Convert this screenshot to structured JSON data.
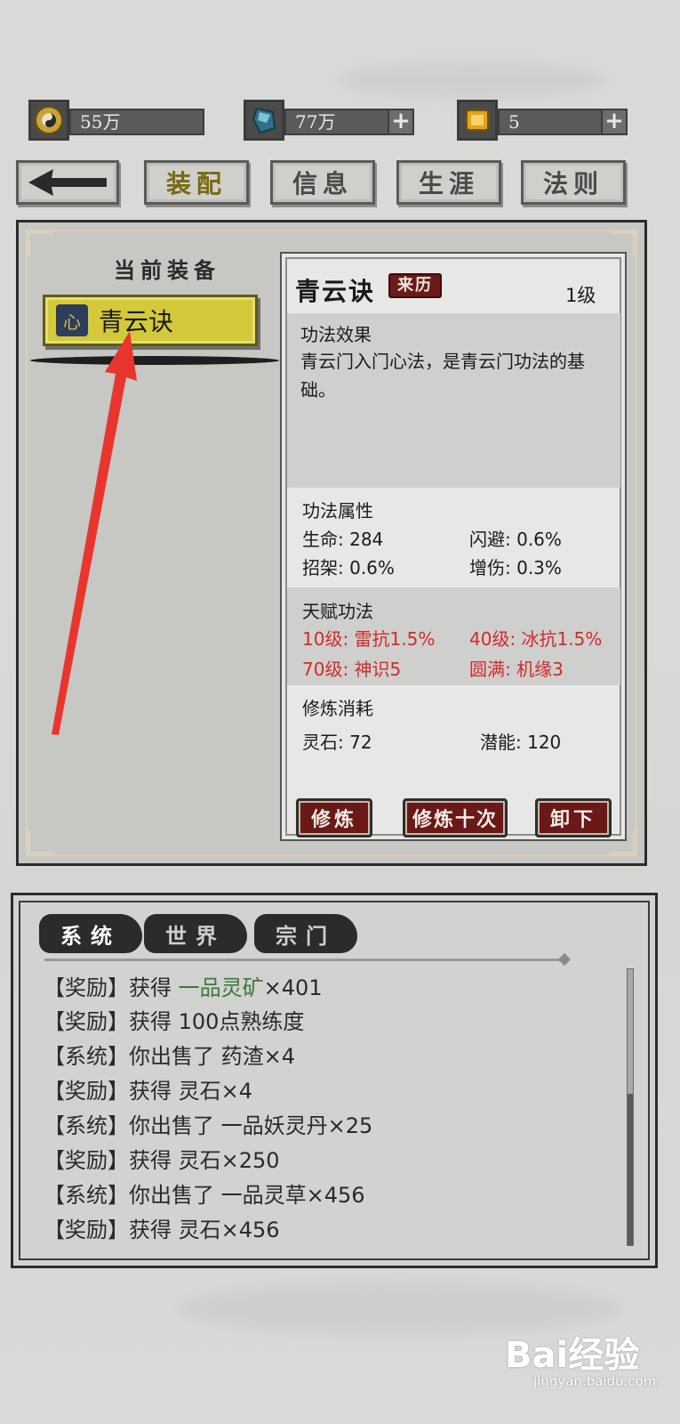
{
  "resources": [
    {
      "icon": "yin-yang-coin-icon",
      "value": "55万",
      "has_plus": false
    },
    {
      "icon": "blue-crystal-icon",
      "value": "77万",
      "has_plus": true
    },
    {
      "icon": "gold-gem-icon",
      "value": "5",
      "has_plus": true
    }
  ],
  "nav": {
    "back_icon": "back-arrow-icon",
    "tabs": [
      "装配",
      "信息",
      "生涯",
      "法则"
    ],
    "active_tab": "装配"
  },
  "equip": {
    "header": "当前装备",
    "item_icon_glyph": "心",
    "item_name": "青云诀"
  },
  "detail": {
    "name": "青云诀",
    "origin_button": "来历",
    "level": "1级",
    "effect_title": "功法效果",
    "effect_text_line1": "青云门入门心法，是青云门功法的基",
    "effect_text_line2": "础。",
    "attr_title": "功法属性",
    "attrs": [
      {
        "label": "生命: 284"
      },
      {
        "label": "闪避: 0.6%"
      },
      {
        "label": "招架: 0.6%"
      },
      {
        "label": "增伤: 0.3%"
      }
    ],
    "talent_title": "天赋功法",
    "talents": [
      {
        "label": "10级: 雷抗1.5%"
      },
      {
        "label": "40级: 冰抗1.5%"
      },
      {
        "label": "70级: 神识5"
      },
      {
        "label": "圆满: 机缘3"
      }
    ],
    "cost_title": "修炼消耗",
    "cost_stone": "灵石: 72",
    "cost_potential": "潜能: 120",
    "buttons": {
      "train": "修炼",
      "train_ten": "修炼十次",
      "unequip": "卸下"
    },
    "talent_color": "#d32a2a"
  },
  "chat": {
    "tabs": [
      "系统",
      "世界",
      "宗门"
    ],
    "messages": [
      {
        "tag": "【奖励】",
        "pre": "获得 ",
        "highlight": "一品灵矿",
        "post": "×401"
      },
      {
        "tag": "【奖励】",
        "pre": "获得 100点熟练度",
        "highlight": "",
        "post": ""
      },
      {
        "tag": "【系统】",
        "pre": "你出售了 药渣×4",
        "highlight": "",
        "post": ""
      },
      {
        "tag": "【奖励】",
        "pre": "获得 灵石×4",
        "highlight": "",
        "post": ""
      },
      {
        "tag": "【系统】",
        "pre": "你出售了 一品妖灵丹×25",
        "highlight": "",
        "post": ""
      },
      {
        "tag": "【奖励】",
        "pre": "获得 灵石×250",
        "highlight": "",
        "post": ""
      },
      {
        "tag": "【系统】",
        "pre": "你出售了 一品灵草×456",
        "highlight": "",
        "post": ""
      },
      {
        "tag": "【奖励】",
        "pre": "获得 灵石×456",
        "highlight": "",
        "post": ""
      }
    ],
    "highlight_color": "#3b7a3b"
  },
  "watermark": {
    "brand": "Bai经验",
    "url": "jingyan.baidu.com"
  },
  "annotation_color": "#e8362f"
}
